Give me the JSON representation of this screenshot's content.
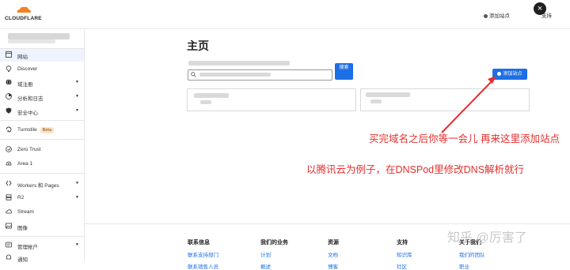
{
  "header": {
    "logo_text": "CLOUDFLARE",
    "add_site_label": "添加站点",
    "help_label": "支持",
    "close_glyph": "×"
  },
  "sidebar": {
    "items": [
      {
        "label": "网站",
        "icon": "browser-window-icon",
        "chevron": false,
        "active": true
      },
      {
        "label": "Discover",
        "icon": "lightbulb-icon",
        "chevron": false
      },
      {
        "label": "域注册",
        "icon": "globe-icon",
        "chevron": true
      },
      {
        "label": "分析和日志",
        "icon": "pie-chart-icon",
        "chevron": true
      },
      {
        "label": "安全中心",
        "icon": "shield-icon",
        "chevron": true
      },
      {
        "label": "Turnstile",
        "icon": "turnstile-icon",
        "chevron": false,
        "badge": "Beta"
      },
      {
        "label": "Zero Trust",
        "icon": "zero-trust-icon",
        "chevron": false
      },
      {
        "label": "Area 1",
        "icon": "area1-icon",
        "chevron": false
      },
      {
        "label": "Workers 和 Pages",
        "icon": "workers-icon",
        "chevron": true
      },
      {
        "label": "R2",
        "icon": "storage-icon",
        "chevron": true
      },
      {
        "label": "Stream",
        "icon": "cloud-stream-icon",
        "chevron": false
      },
      {
        "label": "图像",
        "icon": "image-icon",
        "chevron": false
      },
      {
        "label": "管理帐户",
        "icon": "account-gear-icon",
        "chevron": true
      },
      {
        "label": "通知",
        "icon": "bell-icon",
        "chevron": false
      }
    ]
  },
  "main": {
    "title": "主页",
    "search_button_label": "搜索",
    "add_site_button_label": "添加站点"
  },
  "annotations": {
    "line1": "买完域名之后你等一会儿 再来这里添加站点",
    "line2": "以腾讯云为例子，在DNSPod里修改DNS解析就行",
    "color": "#e52e2e"
  },
  "footer": {
    "columns": [
      {
        "heading": "联系信息",
        "links": [
          "联系支持部门",
          "联系销售人员"
        ]
      },
      {
        "heading": "我们的业务",
        "links": [
          "计划",
          "概述"
        ]
      },
      {
        "heading": "资源",
        "links": [
          "文档",
          "博客"
        ]
      },
      {
        "heading": "支持",
        "links": [
          "知识库",
          "社区"
        ]
      },
      {
        "heading": "关于我们",
        "links": [
          "我们的团队",
          "职业"
        ]
      }
    ]
  },
  "watermark": "知乎 @厉害了",
  "colors": {
    "accent": "#1d6fe6",
    "logo_orange": "#f48120",
    "annotation": "#e52e2e"
  }
}
